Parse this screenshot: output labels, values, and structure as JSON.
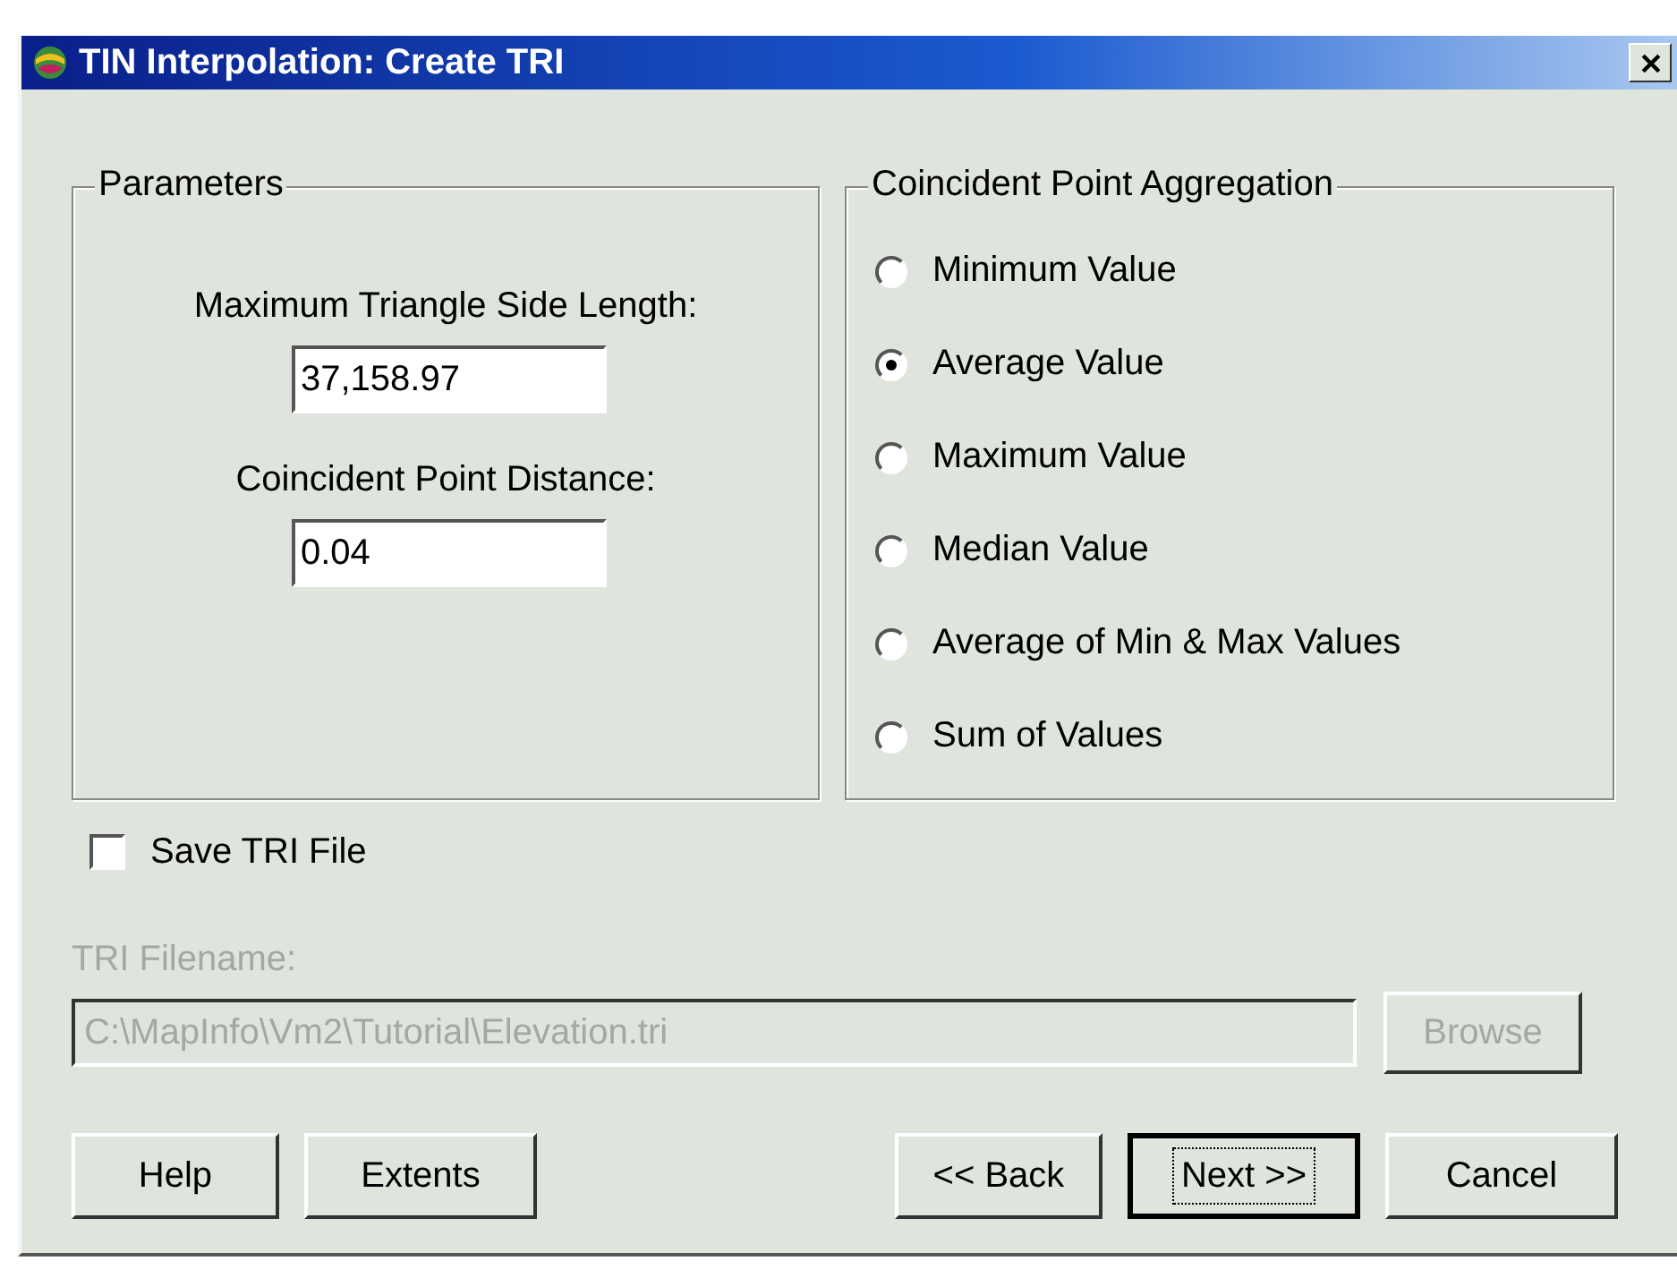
{
  "window": {
    "title": "TIN Interpolation: Create TRI"
  },
  "parameters": {
    "title": "Parameters",
    "fields": [
      {
        "label": "Maximum Triangle Side Length:",
        "value": "37,158.97"
      },
      {
        "label": "Coincident Point Distance:",
        "value": "0.04"
      }
    ]
  },
  "aggregation": {
    "title": "Coincident Point Aggregation",
    "options": [
      {
        "label": "Minimum Value",
        "selected": false
      },
      {
        "label": "Average Value",
        "selected": true
      },
      {
        "label": "Maximum Value",
        "selected": false
      },
      {
        "label": "Median Value",
        "selected": false
      },
      {
        "label": "Average of Min & Max Values",
        "selected": false
      },
      {
        "label": "Sum of Values",
        "selected": false
      }
    ]
  },
  "save_tri": {
    "label": "Save TRI File",
    "checked": false
  },
  "filename": {
    "label": "TRI Filename:",
    "value": "C:\\MapInfo\\Vm2\\Tutorial\\Elevation.tri",
    "disabled": true,
    "browse": "Browse"
  },
  "buttons_left": [
    {
      "label": "Help",
      "default": false
    },
    {
      "label": "Extents",
      "default": false
    }
  ],
  "buttons_right": [
    {
      "label": "<< Back",
      "default": false
    },
    {
      "label": "Next >>",
      "default": true
    },
    {
      "label": "Cancel",
      "default": false
    }
  ]
}
